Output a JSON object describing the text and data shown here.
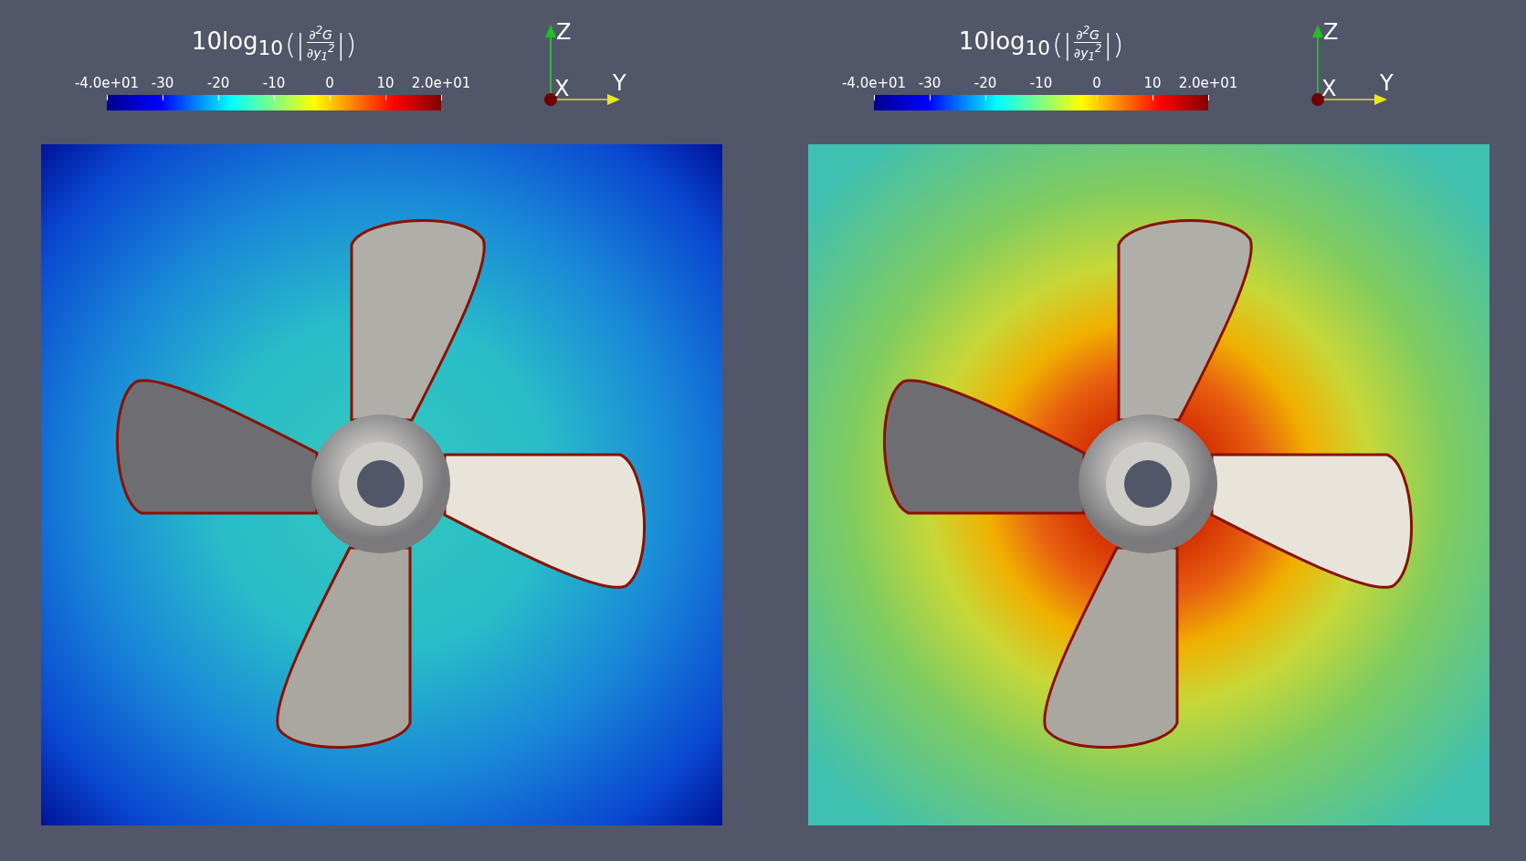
{
  "panels": [
    {
      "legend": {
        "lead": "10log$_{10}$",
        "open": "(|",
        "numerator": "∂$^{2}$G",
        "denominator": "∂y$_{1}$$^{2}$",
        "close": "|)",
        "ticks": [
          "-4.0e+01",
          "-30",
          "-20",
          "-10",
          "0",
          "10",
          "2.0e+01"
        ]
      },
      "axes": {
        "z": "Z",
        "x": "X",
        "y": "Y"
      },
      "view": {
        "kind": "smooth"
      }
    },
    {
      "legend": {
        "lead": "10log$_{10}$",
        "open": "(|",
        "numerator": "∂$^{2}$G",
        "denominator": "∂y$_{1}$$^{2}$",
        "close": "|)",
        "ticks": [
          "-4.0e+01",
          "-30",
          "-20",
          "-10",
          "0",
          "10",
          "2.0e+01"
        ]
      },
      "axes": {
        "z": "Z",
        "x": "X",
        "y": "Y"
      },
      "view": {
        "kind": "turbulent"
      }
    }
  ]
}
